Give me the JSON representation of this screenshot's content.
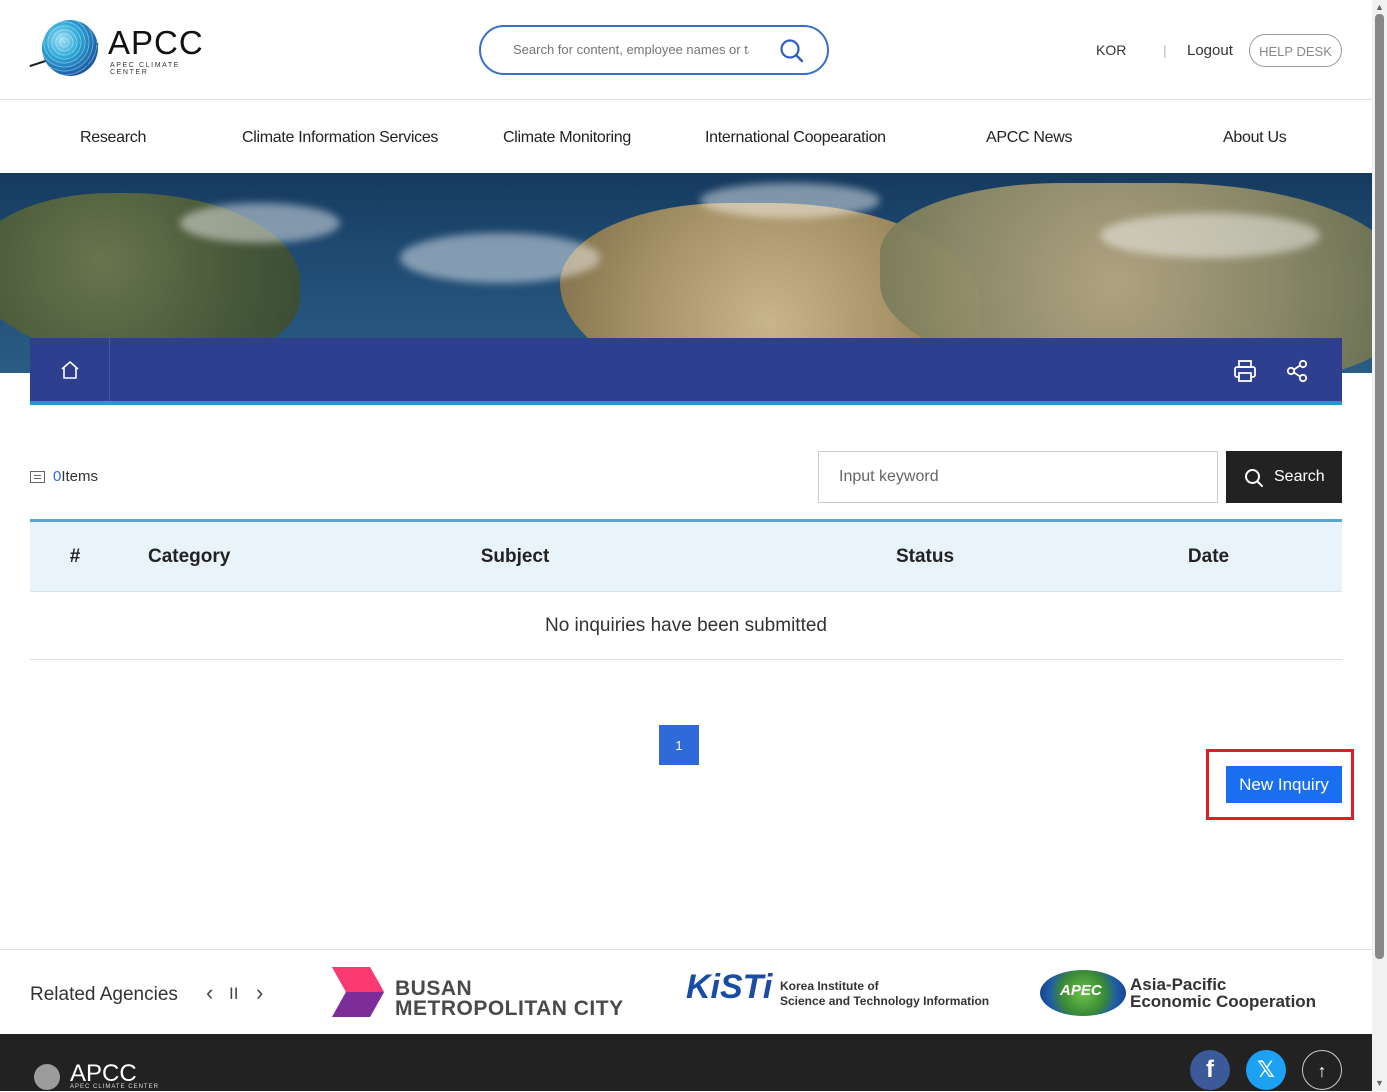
{
  "header": {
    "logo_text": "APCC",
    "logo_sub": "APEC CLIMATE CENTER",
    "search_placeholder": "Search for content, employee names or tasks",
    "lang": "KOR",
    "separator": "|",
    "logout": "Logout",
    "helpdesk": "HELP DESK"
  },
  "nav": {
    "items": [
      "Research",
      "Climate Information Services",
      "Climate Monitoring",
      "International Coopearation",
      "APCC News",
      "About Us"
    ]
  },
  "list": {
    "count_num": "0",
    "count_suffix": "Items",
    "keyword_placeholder": "Input keyword",
    "search_label": "Search"
  },
  "table": {
    "headers": [
      "#",
      "Category",
      "Subject",
      "Status",
      "Date"
    ],
    "empty_message": "No inquiries have been submitted"
  },
  "pagination": {
    "current": "1"
  },
  "actions": {
    "new_inquiry": "New Inquiry"
  },
  "related": {
    "title": "Related Agencies",
    "prev": "‹",
    "pause": "II",
    "next": "›",
    "busan_line1": "BUSAN",
    "busan_line2": "METROPOLITAN CITY",
    "kisti_mark": "KiSTi",
    "kisti_line1": "Korea Institute of",
    "kisti_line2": "Science and Technology Information",
    "apec_word": "APEC",
    "apec_line1": "Asia-Pacific",
    "apec_line2": "Economic Cooperation"
  },
  "footer": {
    "logo_text": "APCC",
    "logo_sub": "APEC CLIMATE CENTER",
    "facebook_icon": "f",
    "twitter_icon": "𝕏",
    "top_icon": "↑"
  },
  "colors": {
    "breadcrumb_bar": "#2e3f8f",
    "accent_blue": "#1a6ef0",
    "highlight_red": "#e01e25"
  }
}
